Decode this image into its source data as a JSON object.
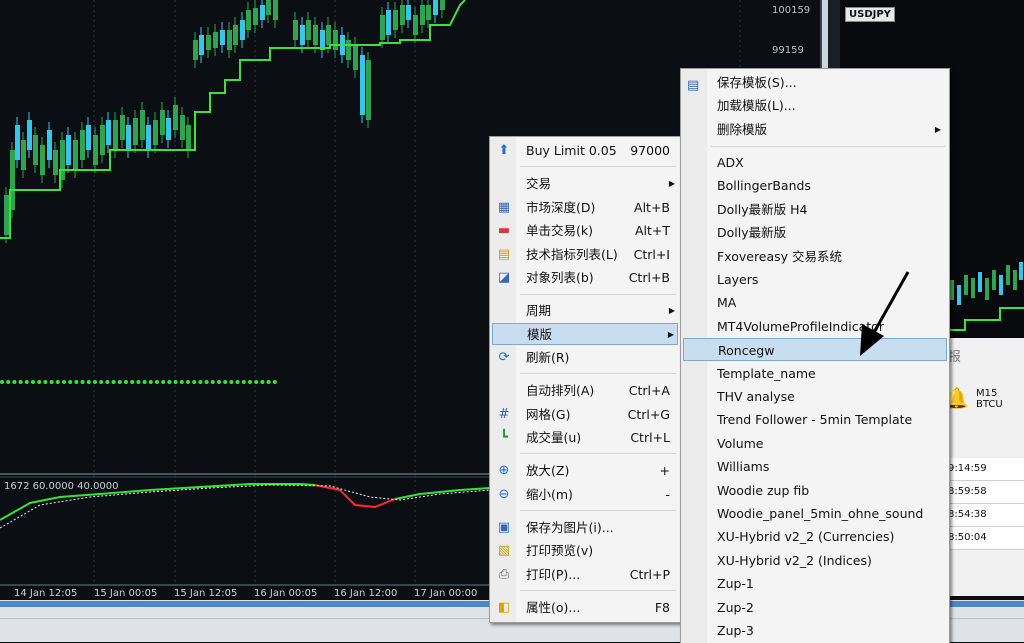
{
  "price_axis": {
    "labels": [
      "100159",
      "99159"
    ]
  },
  "time_axis": {
    "labels": [
      "14 Jan 12:05",
      "15 Jan 00:05",
      "15 Jan 12:05",
      "16 Jan 00:05",
      "16 Jan 12:00",
      "17 Jan 00:00"
    ]
  },
  "indicator": {
    "label": "1672 60.0000 40.0000"
  },
  "symbols": [
    "USDJPY"
  ],
  "side_panel": {
    "title_fragment": "报",
    "alert_label": "M15 BTCU",
    "times": [
      "9:14:59",
      "8:59:58",
      "8:54:38",
      "8:50:04"
    ]
  },
  "context_menu": {
    "items": [
      {
        "name": "buy-limit",
        "label": "Buy Limit 0.05",
        "shortcut": "97000",
        "icon": "up-arrow-icon"
      },
      {
        "name": "trade",
        "label": "交易",
        "submenu": true
      },
      {
        "name": "market-depth",
        "label": "市场深度(D)",
        "shortcut": "Alt+B",
        "icon": "market-depth-icon"
      },
      {
        "name": "one-click-trading",
        "label": "单击交易(k)",
        "shortcut": "Alt+T",
        "icon": "one-click-icon"
      },
      {
        "name": "indicators-list",
        "label": "技术指标列表(L)",
        "shortcut": "Ctrl+I",
        "icon": "indicator-list-icon"
      },
      {
        "name": "objects-list",
        "label": "对象列表(b)",
        "shortcut": "Ctrl+B",
        "icon": "object-list-icon"
      },
      {
        "name": "timeframes",
        "label": "周期",
        "submenu": true
      },
      {
        "name": "templates",
        "label": "模版",
        "submenu": true,
        "highlighted": true
      },
      {
        "name": "refresh",
        "label": "刷新(R)",
        "icon": "refresh-icon"
      },
      {
        "name": "auto-scroll",
        "label": "自动排列(A)",
        "shortcut": "Ctrl+A"
      },
      {
        "name": "grid",
        "label": "网格(G)",
        "shortcut": "Ctrl+G",
        "icon": "grid-icon"
      },
      {
        "name": "volumes",
        "label": "成交量(u)",
        "shortcut": "Ctrl+L",
        "icon": "volume-icon"
      },
      {
        "name": "zoom-in",
        "label": "放大(Z)",
        "shortcut": "+",
        "icon": "zoom-in-icon"
      },
      {
        "name": "zoom-out",
        "label": "缩小(m)",
        "shortcut": "-",
        "icon": "zoom-out-icon"
      },
      {
        "name": "save-as-picture",
        "label": "保存为图片(i)...",
        "icon": "save-picture-icon"
      },
      {
        "name": "print-preview",
        "label": "打印预览(v)",
        "icon": "print-preview-icon"
      },
      {
        "name": "print",
        "label": "打印(P)...",
        "shortcut": "Ctrl+P",
        "icon": "print-icon"
      },
      {
        "name": "properties",
        "label": "属性(o)...",
        "shortcut": "F8",
        "icon": "properties-icon"
      }
    ]
  },
  "template_menu": {
    "actions": [
      {
        "name": "save-template",
        "label": "保存模板(S)...",
        "icon": "save-template-icon"
      },
      {
        "name": "load-template",
        "label": "加载模版(L)..."
      },
      {
        "name": "remove-template",
        "label": "删除模版",
        "submenu": true
      }
    ],
    "templates": [
      "ADX",
      "BollingerBands",
      "Dolly最新版 H4",
      "Dolly最新版",
      "Fxovereasy 交易系统",
      "Layers",
      "MA",
      "MT4VolumeProfileIndicator",
      "Roncegw",
      "Template_name",
      "THV analyse",
      "Trend Follower - 5min Template",
      "Volume",
      "Williams",
      "Woodie zup fib",
      "Woodie_panel_5min_ohne_sound",
      "XU-Hybrid v2_2 (Currencies)",
      "XU-Hybrid v2_2 (Indices)",
      "Zup-1",
      "Zup-2",
      "Zup-3"
    ],
    "highlighted": "Roncegw"
  },
  "colors": {
    "background": "#0b0f14",
    "bull": "#2fa44f",
    "bear": "#38c5e8",
    "stop_line": "#3ae23a",
    "highlight": "#c9ddf1"
  }
}
